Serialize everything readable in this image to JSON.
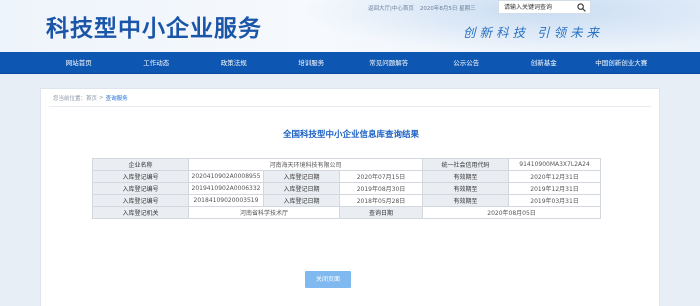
{
  "header": {
    "site_title": "科技型中小企业服务",
    "topbar_link": "返回大厅|中心首页",
    "topbar_date": "2020年8月5日 星期三",
    "search_placeholder": "请输入关键词查询",
    "slogan": "创新科技 引领未来"
  },
  "nav": {
    "items": [
      {
        "label": "网站首页"
      },
      {
        "label": "工作动态"
      },
      {
        "label": "政策法规"
      },
      {
        "label": "培训服务"
      },
      {
        "label": "常见问题解答"
      },
      {
        "label": "公示公告"
      },
      {
        "label": "创新基金"
      },
      {
        "label": "中国创新创业大赛"
      }
    ]
  },
  "breadcrumb": {
    "prefix": "您当前位置：",
    "home": "首页",
    "separator": ">",
    "current": "查询服务"
  },
  "result_title": "全国科技型中小企业信息库查询结果",
  "table": {
    "company_label": "企业名称",
    "company_value": "河南海天环境科技有限公司",
    "credit_code_label": "统一社会信用代码",
    "credit_code_value": "91410900MA3X7L2A24",
    "rows": [
      {
        "reg_no_label": "入库登记编号",
        "reg_no": "2020410902A0008955",
        "reg_date_label": "入库登记日期",
        "reg_date": "2020年07月15日",
        "valid_label": "有效期至",
        "valid_until": "2020年12月31日"
      },
      {
        "reg_no_label": "入库登记编号",
        "reg_no": "2019410902A0006332",
        "reg_date_label": "入库登记日期",
        "reg_date": "2019年08月30日",
        "valid_label": "有效期至",
        "valid_until": "2019年12月31日"
      },
      {
        "reg_no_label": "入库登记编号",
        "reg_no": "20184109020003519",
        "reg_date_label": "入库登记日期",
        "reg_date": "2018年05月28日",
        "valid_label": "有效期至",
        "valid_until": "2019年03月31日"
      }
    ],
    "authority_label": "入库登记机关",
    "authority_value": "河南省科学技术厅",
    "query_date_label": "查询日期",
    "query_date_value": "2020年08月05日"
  },
  "close_button": "关闭页面",
  "colors": {
    "brand_blue": "#0d56b2",
    "title_blue": "#1a55a8",
    "button_blue": "#7fb9ef",
    "content_bg": "#e8eef6",
    "label_cell_bg": "#eaedf2"
  }
}
